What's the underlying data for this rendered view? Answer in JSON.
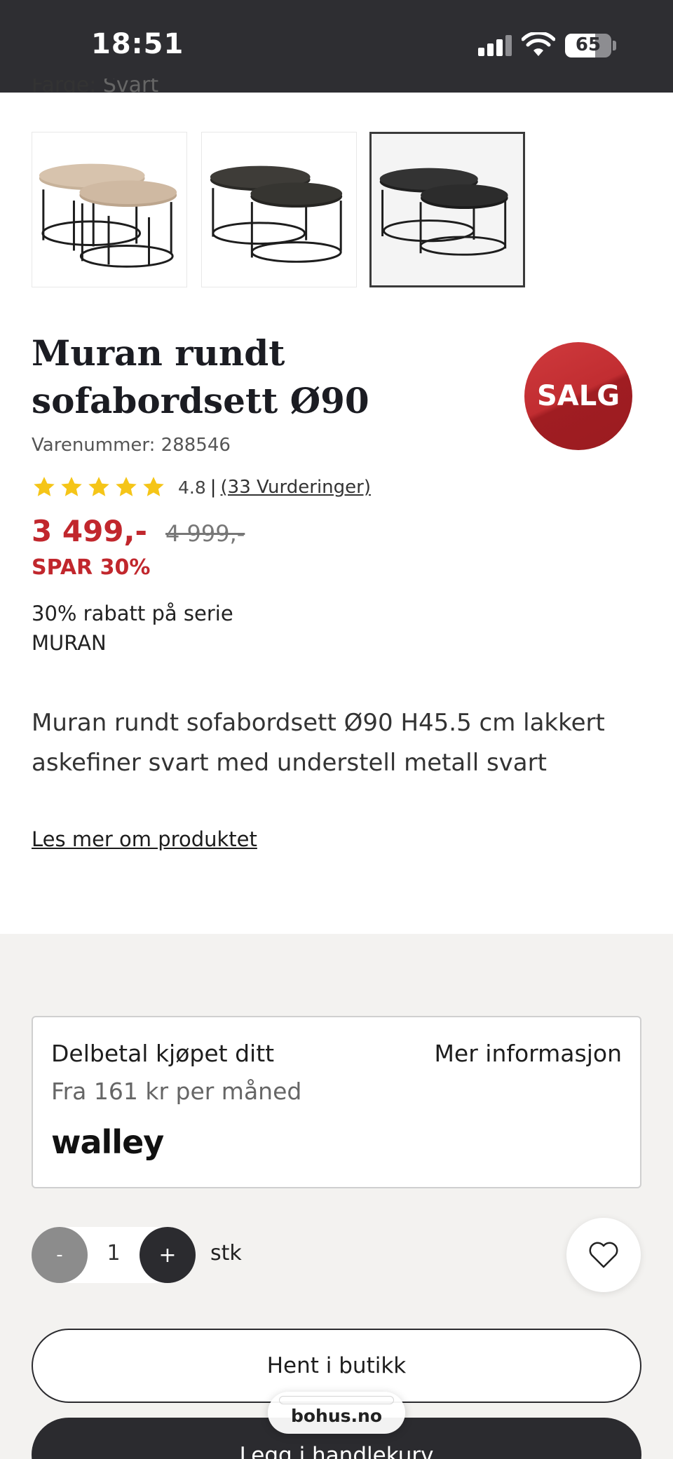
{
  "status_bar": {
    "time": "18:51",
    "battery": "65",
    "battery_level": 0.65,
    "signal_bars": 3
  },
  "product": {
    "color_label": "Farge:",
    "color_value": "Svart",
    "thumbnails": [
      {
        "name": "thumbnail-natural",
        "top_color": "#cdb7a0",
        "selected": false
      },
      {
        "name": "thumbnail-dark-brown",
        "top_color": "#3b3a36",
        "selected": false
      },
      {
        "name": "thumbnail-black",
        "top_color": "#2f2f2f",
        "selected": true
      }
    ],
    "title": "Muran rundt sofabordsett Ø90",
    "sale_badge": "SALG",
    "sku": "Varenummer: 288546",
    "rating": {
      "stars": 5,
      "score": "4.8",
      "separator": "|",
      "reviews": "(33 Vurderinger)"
    },
    "price": "3 499,-",
    "old_price": "4 999,-",
    "saving": "SPAR 30%",
    "series_offer": "30% rabatt på serie MURAN",
    "description": "Muran rundt sofabordsett Ø90 H45.5 cm lakkert askefiner svart med understell metall svart",
    "read_more": "Les mer om produktet"
  },
  "financing": {
    "title": "Delbetal kjøpet ditt",
    "more": "Mer informasjon",
    "subtitle": "Fra 161 kr per måned",
    "provider": "walley"
  },
  "purchase": {
    "minus": "-",
    "quantity": "1",
    "plus": "+",
    "unit": "stk",
    "pickup_button": "Hent i butikk",
    "cart_button": "Legg i handlekurv"
  },
  "browser": {
    "url": "bohus.no"
  },
  "colors": {
    "accent_red": "#c1272d",
    "dark": "#2b2b2f",
    "star": "#f5c518"
  }
}
